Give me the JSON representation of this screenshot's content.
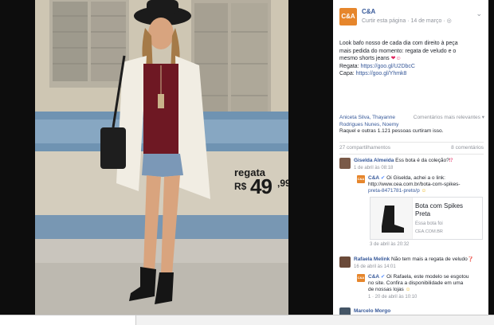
{
  "photo": {
    "price_label": "regata",
    "price_currency": "R$",
    "price_integer": "49",
    "price_decimals": ",99"
  },
  "post": {
    "page_name": "C&A",
    "meta": "Curtir esta página · 14 de março ·",
    "globe_icon": "globe-icon",
    "menu_icon": "chevron-down-icon",
    "avatar_text": "C&A",
    "text_lines": [
      "Look bafo nosso de cada dia com direito à peça",
      "mais pedida do momento: regata de veludo e o",
      "mesmo shorts jeans"
    ],
    "regata_link_label": "Regata: ",
    "regata_link": "https://goo.gl/U2DbcC",
    "capa_link_label": "Capa: ",
    "capa_link": "https://goo.gl/Yhmk8"
  },
  "likes": {
    "line1": "Aniceta Silva, Thayanne",
    "line2": "Rodrigues Nunes, Noemy",
    "line3": "Raquel e outras 1.121 pessoas curtiram isso.",
    "relevance": "Comentários mais relevantes ▾"
  },
  "counts": {
    "shares": "27 compartilhamentos",
    "comments": "8 comentários"
  },
  "comments": [
    {
      "name": "Giselda Almeida",
      "text": "Ess bota é da coleção?",
      "meta": "1 de abril às 08:18"
    },
    {
      "name": "C&A",
      "text_line1": "Oi Giselda, achei a o link:",
      "link_line1": "http://www.cea.com.br/bota-com-spikes-",
      "link_line2": "preta-8471781-preto/p",
      "meta": "3 de abril às 20:32"
    },
    {
      "name": "Rafaela Melink",
      "text": "Não tem mais a regata de veludo",
      "meta": "16 de abril às 14:01"
    },
    {
      "name": "C&A",
      "text_line1": "Oi Rafaela, este modelo se esgotou",
      "text_line2": "no site. Confira a disponibilidade em uma",
      "text_line3": "de nossas lojas",
      "meta": "1 · 20 de abril às 10:10"
    },
    {
      "name": "Marcelo Morgo",
      "text": "",
      "meta": ""
    }
  ],
  "link_card": {
    "title_line1": "Bota com Spikes",
    "title_line2": "Preta",
    "desc": "Essa bota foi",
    "domain": "CEA.COM.BR"
  },
  "colors": {
    "fb_blue": "#365899",
    "brand_orange": "#e6862c",
    "muted": "#90949c"
  }
}
